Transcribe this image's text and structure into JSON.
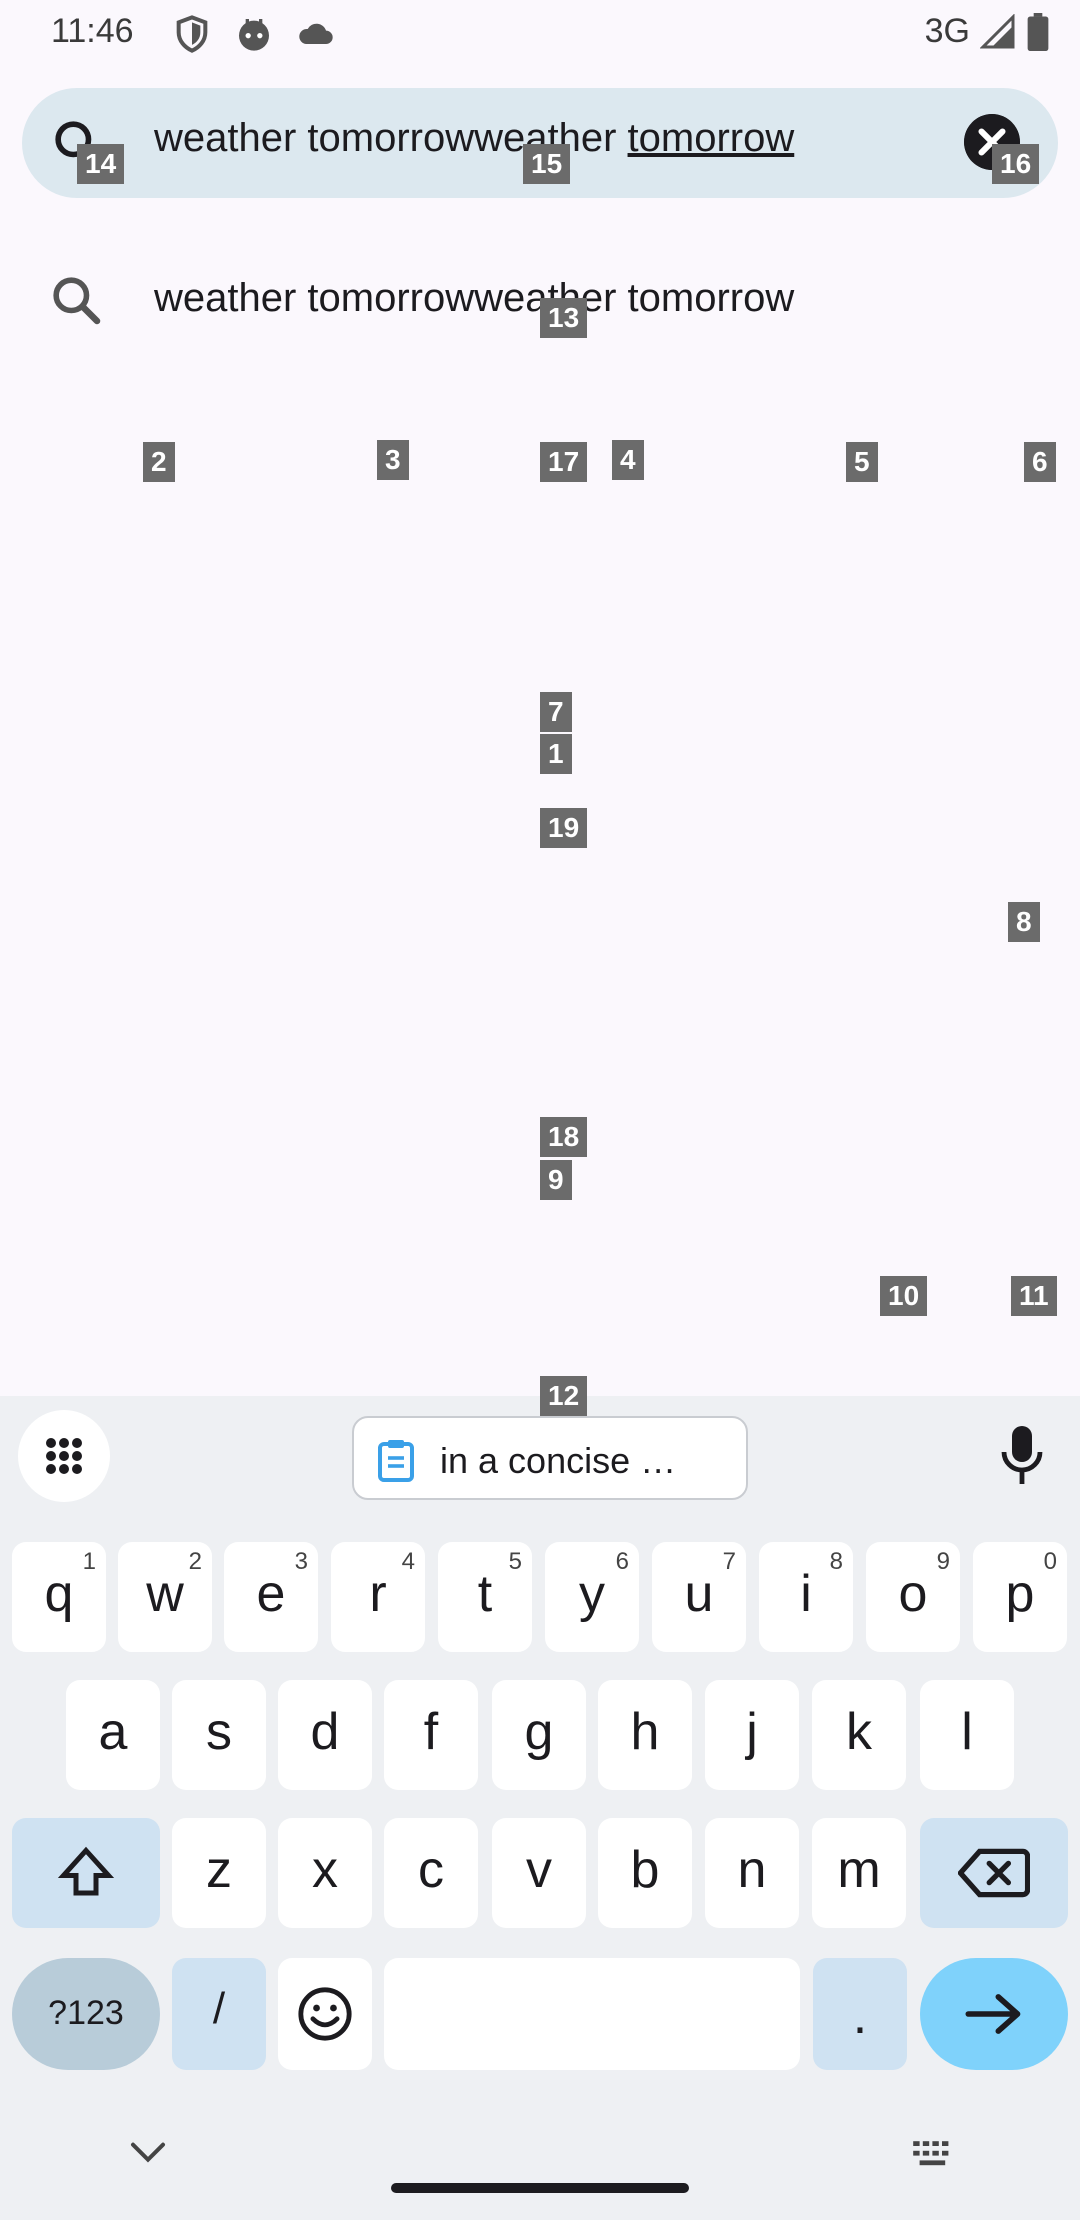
{
  "status_bar": {
    "time": "11:46",
    "network": "3G",
    "icons": [
      "shield-icon",
      "android-face-icon",
      "cloud-icon",
      "signal-icon",
      "battery-icon"
    ]
  },
  "search": {
    "query_plain": "weather tomorrowweather ",
    "query_underlined": "tomorrow",
    "icons": [
      "search-icon",
      "clear-icon"
    ]
  },
  "suggestions": [
    {
      "text": "weather tomorrowweather tomorrow"
    }
  ],
  "markers": [
    "1",
    "2",
    "3",
    "4",
    "5",
    "6",
    "7",
    "8",
    "9",
    "10",
    "11",
    "12",
    "13",
    "14",
    "15",
    "16",
    "17",
    "18",
    "19"
  ],
  "keyboard": {
    "clipboard_chip": "in a concise …",
    "row1": [
      {
        "k": "q",
        "s": "1"
      },
      {
        "k": "w",
        "s": "2"
      },
      {
        "k": "e",
        "s": "3"
      },
      {
        "k": "r",
        "s": "4"
      },
      {
        "k": "t",
        "s": "5"
      },
      {
        "k": "y",
        "s": "6"
      },
      {
        "k": "u",
        "s": "7"
      },
      {
        "k": "i",
        "s": "8"
      },
      {
        "k": "o",
        "s": "9"
      },
      {
        "k": "p",
        "s": "0"
      }
    ],
    "row2": [
      "a",
      "s",
      "d",
      "f",
      "g",
      "h",
      "j",
      "k",
      "l"
    ],
    "row3": [
      "z",
      "x",
      "c",
      "v",
      "b",
      "n",
      "m"
    ],
    "symbols_label": "?123",
    "slash": "/",
    "period": ".",
    "colors": {
      "accent": "#7fd2fb",
      "modifier": "#cfe2f2",
      "background": "#eef0f3"
    }
  }
}
